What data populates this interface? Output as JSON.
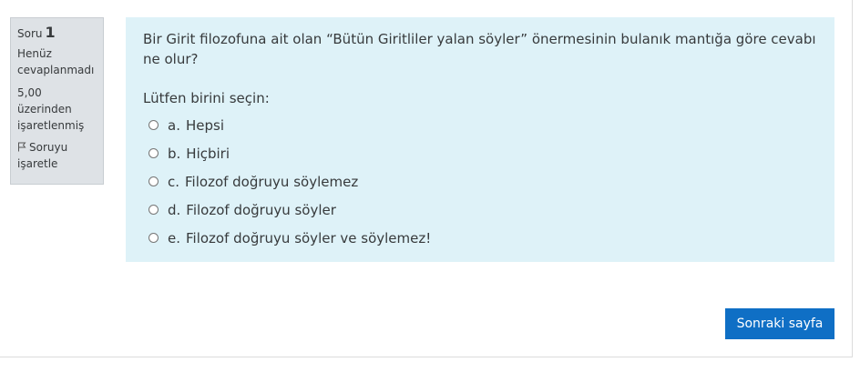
{
  "question_info": {
    "label": "Soru",
    "number": "1",
    "state": "Henüz cevaplanmadı",
    "grade": "5,00 üzerinden işaretlenmiş",
    "flag_label": "Soruyu işaretle",
    "flag_icon": "flag-icon"
  },
  "question": {
    "text": "Bir Girit filozofuna ait olan “Bütün Giritliler yalan söyler” önermesinin bulanık mantığa göre cevabı ne olur?",
    "prompt": "Lütfen birini seçin:",
    "answers": [
      {
        "letter": "a.",
        "text": "Hepsi"
      },
      {
        "letter": "b.",
        "text": "Hiçbiri"
      },
      {
        "letter": "c.",
        "text": "Filozof doğruyu söylemez"
      },
      {
        "letter": "d.",
        "text": "Filozof doğruyu söyler"
      },
      {
        "letter": "e.",
        "text": "Filozof doğruyu söyler ve söylemez!"
      }
    ]
  },
  "navigation": {
    "next_label": "Sonraki sayfa"
  },
  "colors": {
    "content_bg": "#def2f8",
    "info_bg": "#dee2e6",
    "button_bg": "#0f6fc5"
  }
}
